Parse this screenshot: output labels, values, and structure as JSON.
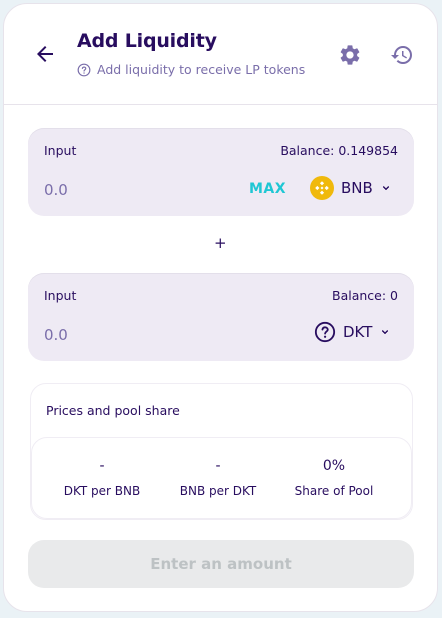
{
  "header": {
    "title": "Add Liquidity",
    "subtitle": "Add liquidity to receive LP tokens",
    "icons": [
      "back-arrow-icon",
      "help-circle-icon",
      "gear-icon",
      "history-icon"
    ]
  },
  "input_a": {
    "label": "Input",
    "balance": "Balance: 0.149854",
    "value": "",
    "placeholder": "0.0",
    "max_label": "MAX",
    "token": "BNB",
    "token_icon": "bnb-logo-icon"
  },
  "separator": "+",
  "input_b": {
    "label": "Input",
    "balance": "Balance: 0",
    "value": "",
    "placeholder": "0.0",
    "token": "DKT",
    "token_icon": "unknown-token-icon"
  },
  "prices": {
    "title": "Prices and pool share",
    "stats": [
      {
        "value": "-",
        "label": "DKT per BNB"
      },
      {
        "value": "-",
        "label": "BNB per DKT"
      },
      {
        "value": "0%",
        "label": "Share of Pool"
      }
    ]
  },
  "submit_label": "Enter an amount",
  "colors": {
    "primary_text": "#280d5f",
    "secondary_text": "#7a6eaa",
    "accent": "#1fc7d4",
    "input_bg": "#eeeaf4",
    "bnb_yellow": "#f0b90b",
    "disabled_bg": "#e9eaeb",
    "disabled_text": "#bdc2c4"
  }
}
